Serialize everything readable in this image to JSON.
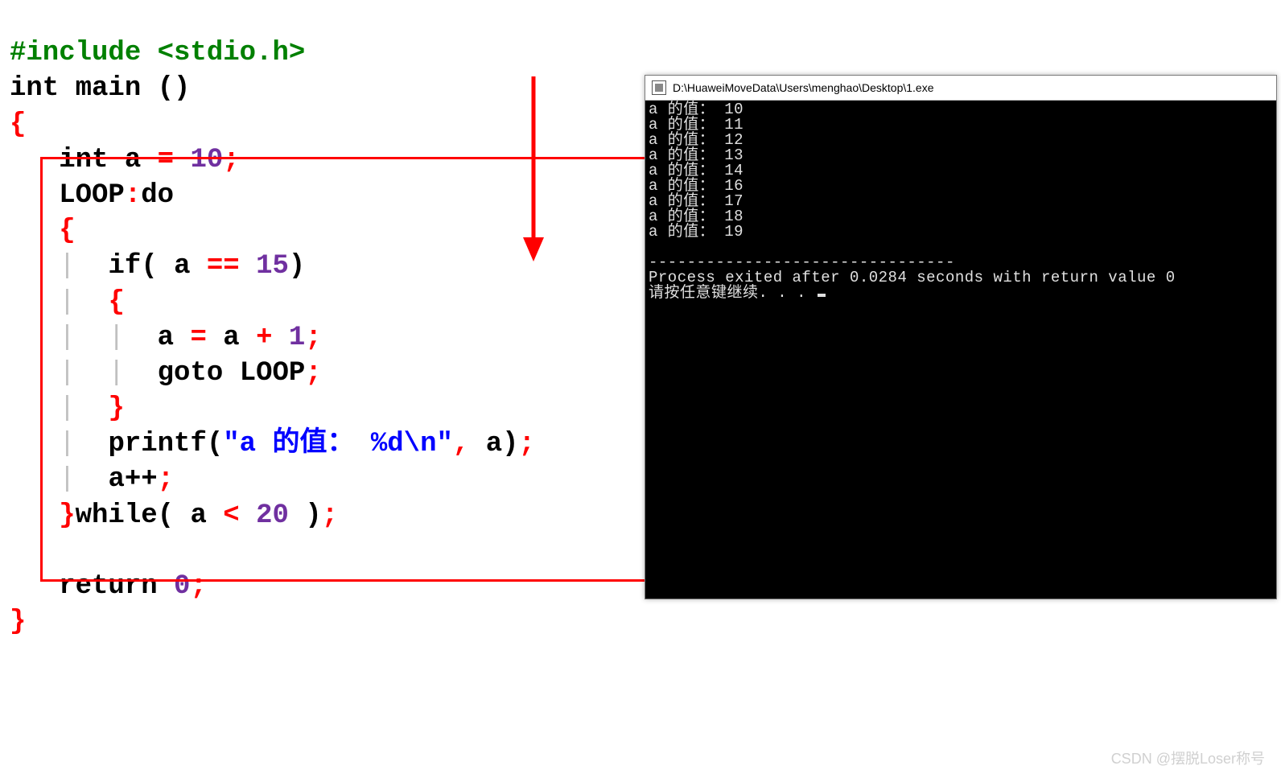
{
  "code": {
    "include": "#include <stdio.h>",
    "main_return_type": "int",
    "main_name": "main",
    "open_brace": "{",
    "close_brace": "}",
    "decl_type": "int",
    "decl_var": "a",
    "assign_op": "=",
    "init_val": "10",
    "semi": ";",
    "label": "LOOP",
    "colon": ":",
    "do_kw": "do",
    "if_kw": "if",
    "cmp_var": "a",
    "eq_op": "==",
    "cmp_val": "15",
    "inc_var": "a",
    "plus_op": "+",
    "one": "1",
    "goto_kw": "goto",
    "goto_target": "LOOP",
    "printf_name": "printf",
    "printf_str": "\"a 的值： %d\\n\"",
    "printf_arg": "a",
    "postinc": "a++",
    "while_kw": "while",
    "cond_var": "a",
    "lt_op": "<",
    "limit_val": "20",
    "return_kw": "return",
    "return_val": "0"
  },
  "console": {
    "title": "D:\\HuaweiMoveData\\Users\\menghao\\Desktop\\1.exe",
    "output_label": "a 的值：",
    "output_values": [
      "10",
      "11",
      "12",
      "13",
      "14",
      "16",
      "17",
      "18",
      "19"
    ],
    "separator": "--------------------------------",
    "exit_line": "Process exited after 0.0284 seconds with return value 0",
    "press_any_key": "请按任意键继续. . . "
  },
  "watermark": "CSDN @摆脱Loser称号"
}
